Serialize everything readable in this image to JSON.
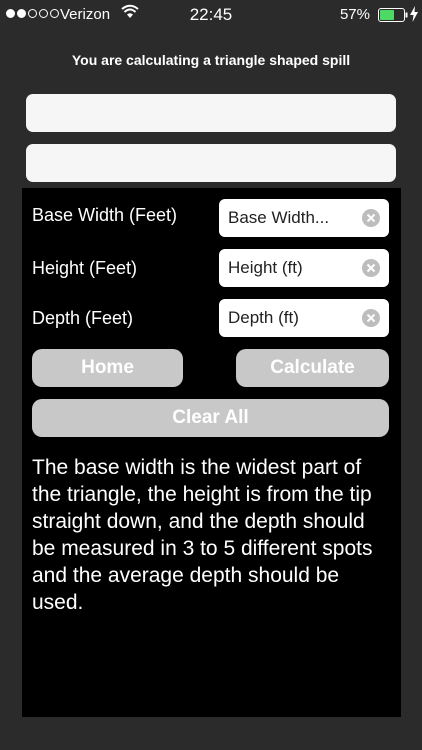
{
  "status_bar": {
    "carrier": "Verizon",
    "time": "22:45",
    "battery": "57%"
  },
  "header": {
    "title": "You are calculating a triangle shaped spill"
  },
  "form": {
    "base_width": {
      "label": "Base Width (Feet)",
      "placeholder": "Base Width..."
    },
    "height": {
      "label": "Height (Feet)",
      "placeholder": "Height (ft)"
    },
    "depth": {
      "label": "Depth (Feet)",
      "placeholder": "Depth (ft)"
    }
  },
  "buttons": {
    "home": "Home",
    "calculate": "Calculate",
    "clear_all": "Clear All"
  },
  "help": {
    "text": "The base width is the widest part of the triangle, the height is from the tip straight down, and the depth should be measured in 3 to 5 different spots and the average depth should be used."
  },
  "colors": {
    "background": "#2b2b2b",
    "panel": "#000000",
    "button": "#c8c8c8"
  }
}
